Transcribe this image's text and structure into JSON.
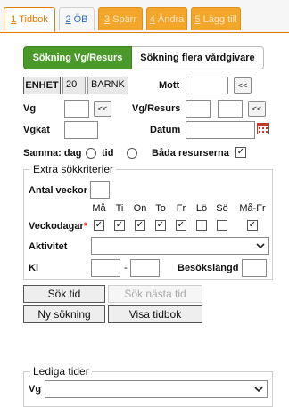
{
  "tabs": [
    {
      "num": "1",
      "label": "Tidbok"
    },
    {
      "num": "2",
      "label": "ÖB"
    },
    {
      "num": "3",
      "label": "Spärr"
    },
    {
      "num": "4",
      "label": "Ändra"
    },
    {
      "num": "5",
      "label": "Lägg till"
    }
  ],
  "search_mode": {
    "active": "Sökning Vg/Resurs",
    "other": "Sökning flera vårdgivare"
  },
  "enhet": {
    "label": "ENHET",
    "code": "20",
    "name": "BARNK"
  },
  "mott": {
    "label": "Mott",
    "value": "",
    "button": "<<"
  },
  "vg": {
    "label": "Vg",
    "value": "",
    "button": "<<"
  },
  "vg_resurs": {
    "label": "Vg/Resurs",
    "button": "<<"
  },
  "vgkat": {
    "label": "Vgkat",
    "value": ""
  },
  "datum": {
    "label": "Datum",
    "value": ""
  },
  "samma": {
    "label": "Samma: dag",
    "dag_checked": false,
    "tid_label": "tid",
    "tid_checked": false,
    "bada_label": "Båda resurserna",
    "bada_checked": true
  },
  "extra": {
    "legend": "Extra sökkriterier",
    "antal_veckor": "Antal veckor",
    "days": [
      "Må",
      "Ti",
      "On",
      "To",
      "Fr",
      "Lö",
      "Sö",
      "Må-Fr"
    ],
    "veckodagar_label": "Veckodagar",
    "required_mark": "*",
    "days_checked": [
      true,
      true,
      true,
      true,
      true,
      false,
      false,
      true
    ],
    "aktivitet_label": "Aktivitet",
    "aktivitet_value": "",
    "kl_label": "Kl",
    "kl_sep": "-",
    "besokslangd_label": "Besökslängd"
  },
  "buttons": {
    "sok_tid": "Sök tid",
    "sok_nasta": "Sök nästa tid",
    "ny_sokning": "Ny sökning",
    "visa_tidbok": "Visa tidbok"
  },
  "lediga": {
    "legend": "Lediga tider",
    "vg_label": "Vg",
    "vg_value": ""
  },
  "colors": {
    "accent": "#e07b00",
    "tab": "#f4a62a",
    "green": "#4a9a2a"
  }
}
